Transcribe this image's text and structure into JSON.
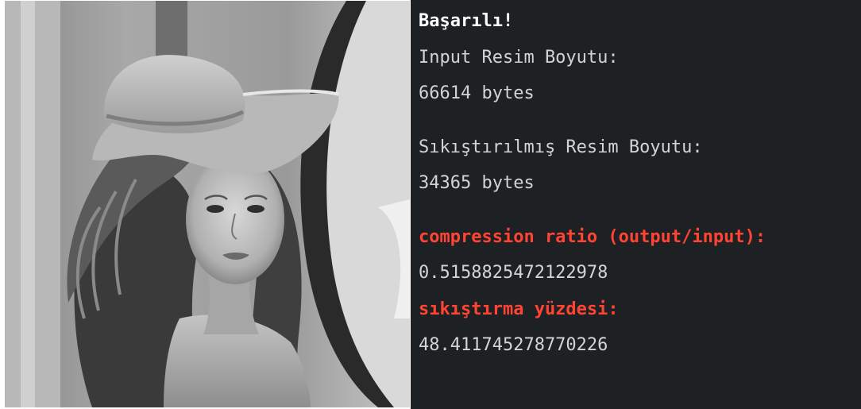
{
  "image": {
    "label": "",
    "alt": "Grayscale portrait photograph of a woman wearing a wide-brimmed hat with feathers"
  },
  "console": {
    "status": "Başarılı!",
    "input_label": "Input Resim Boyutu:",
    "input_value": "66614 bytes",
    "compressed_label": "Sıkıştırılmış Resim Boyutu:",
    "compressed_value": "34365 bytes",
    "ratio_label": "compression ratio (output/input):",
    "ratio_value": "0.5158825472122978",
    "percent_label": "sıkıştırma yüzdesi:",
    "percent_value": "48.411745278770226"
  },
  "colors": {
    "console_background": "#1e2124",
    "console_text": "#d4d4d4",
    "highlight_red": "#ff4433"
  }
}
